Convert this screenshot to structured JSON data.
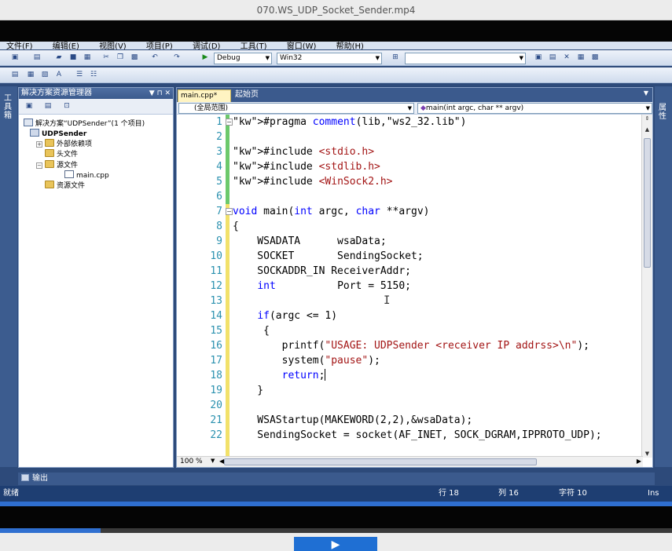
{
  "player": {
    "title": "070.WS_UDP_Socket_Sender.mp4",
    "progress_percent": 15
  },
  "ide": {
    "menu": [
      "文件(F)",
      "编辑(E)",
      "视图(V)",
      "项目(P)",
      "调试(D)",
      "工具(T)",
      "窗口(W)",
      "帮助(H)"
    ],
    "toolbar": {
      "config": "Debug",
      "platform": "Win32",
      "find_value": ""
    },
    "toolbox_label": "工具箱",
    "right_panel_label": "属性",
    "solution_explorer": {
      "title": "解决方案资源管理器",
      "pin": "▼ ⊓ ✕",
      "solution": "解决方案“UDPSender”(1 个项目)",
      "project": "UDPSender",
      "nodes": {
        "external": "外部依赖项",
        "headers": "头文件",
        "sources": "源文件",
        "main_cpp": "main.cpp",
        "resources": "资源文件"
      }
    },
    "editor": {
      "active_tab": "main.cpp*",
      "inactive_tab": "起始页",
      "scope": "(全局范围)",
      "member": "main(int argc, char ** argv)",
      "zoom": "100 %",
      "lines": [
        {
          "n": "1",
          "text": "#pragma comment(lib,\"ws2_32.lib\")"
        },
        {
          "n": "2",
          "text": ""
        },
        {
          "n": "3",
          "text": "#include <stdio.h>"
        },
        {
          "n": "4",
          "text": "#include <stdlib.h>"
        },
        {
          "n": "5",
          "text": "#include <WinSock2.h>"
        },
        {
          "n": "6",
          "text": ""
        },
        {
          "n": "7",
          "text": "void main(int argc, char **argv)"
        },
        {
          "n": "8",
          "text": "{"
        },
        {
          "n": "9",
          "text": "    WSADATA      wsaData;"
        },
        {
          "n": "10",
          "text": "    SOCKET       SendingSocket;"
        },
        {
          "n": "11",
          "text": "    SOCKADDR_IN ReceiverAddr;"
        },
        {
          "n": "12",
          "text": "    int          Port = 5150;"
        },
        {
          "n": "13",
          "text": ""
        },
        {
          "n": "14",
          "text": "    if(argc <= 1)"
        },
        {
          "n": "15",
          "text": "     {"
        },
        {
          "n": "16",
          "text": "        printf(\"USAGE: UDPSender <receiver IP addrss>\\n\");"
        },
        {
          "n": "17",
          "text": "        system(\"pause\");"
        },
        {
          "n": "18",
          "text": "        return;"
        },
        {
          "n": "19",
          "text": "    }"
        },
        {
          "n": "20",
          "text": ""
        },
        {
          "n": "21",
          "text": "    WSAStartup(MAKEWORD(2,2),&wsaData);"
        },
        {
          "n": "22",
          "text": "    SendingSocket = socket(AF_INET, SOCK_DGRAM,IPPROTO_UDP);"
        }
      ]
    },
    "output_tab": "输出",
    "status": {
      "ready": "就绪",
      "row": "行 18",
      "col": "列 16",
      "char": "字符 10",
      "mode": "Ins"
    }
  }
}
